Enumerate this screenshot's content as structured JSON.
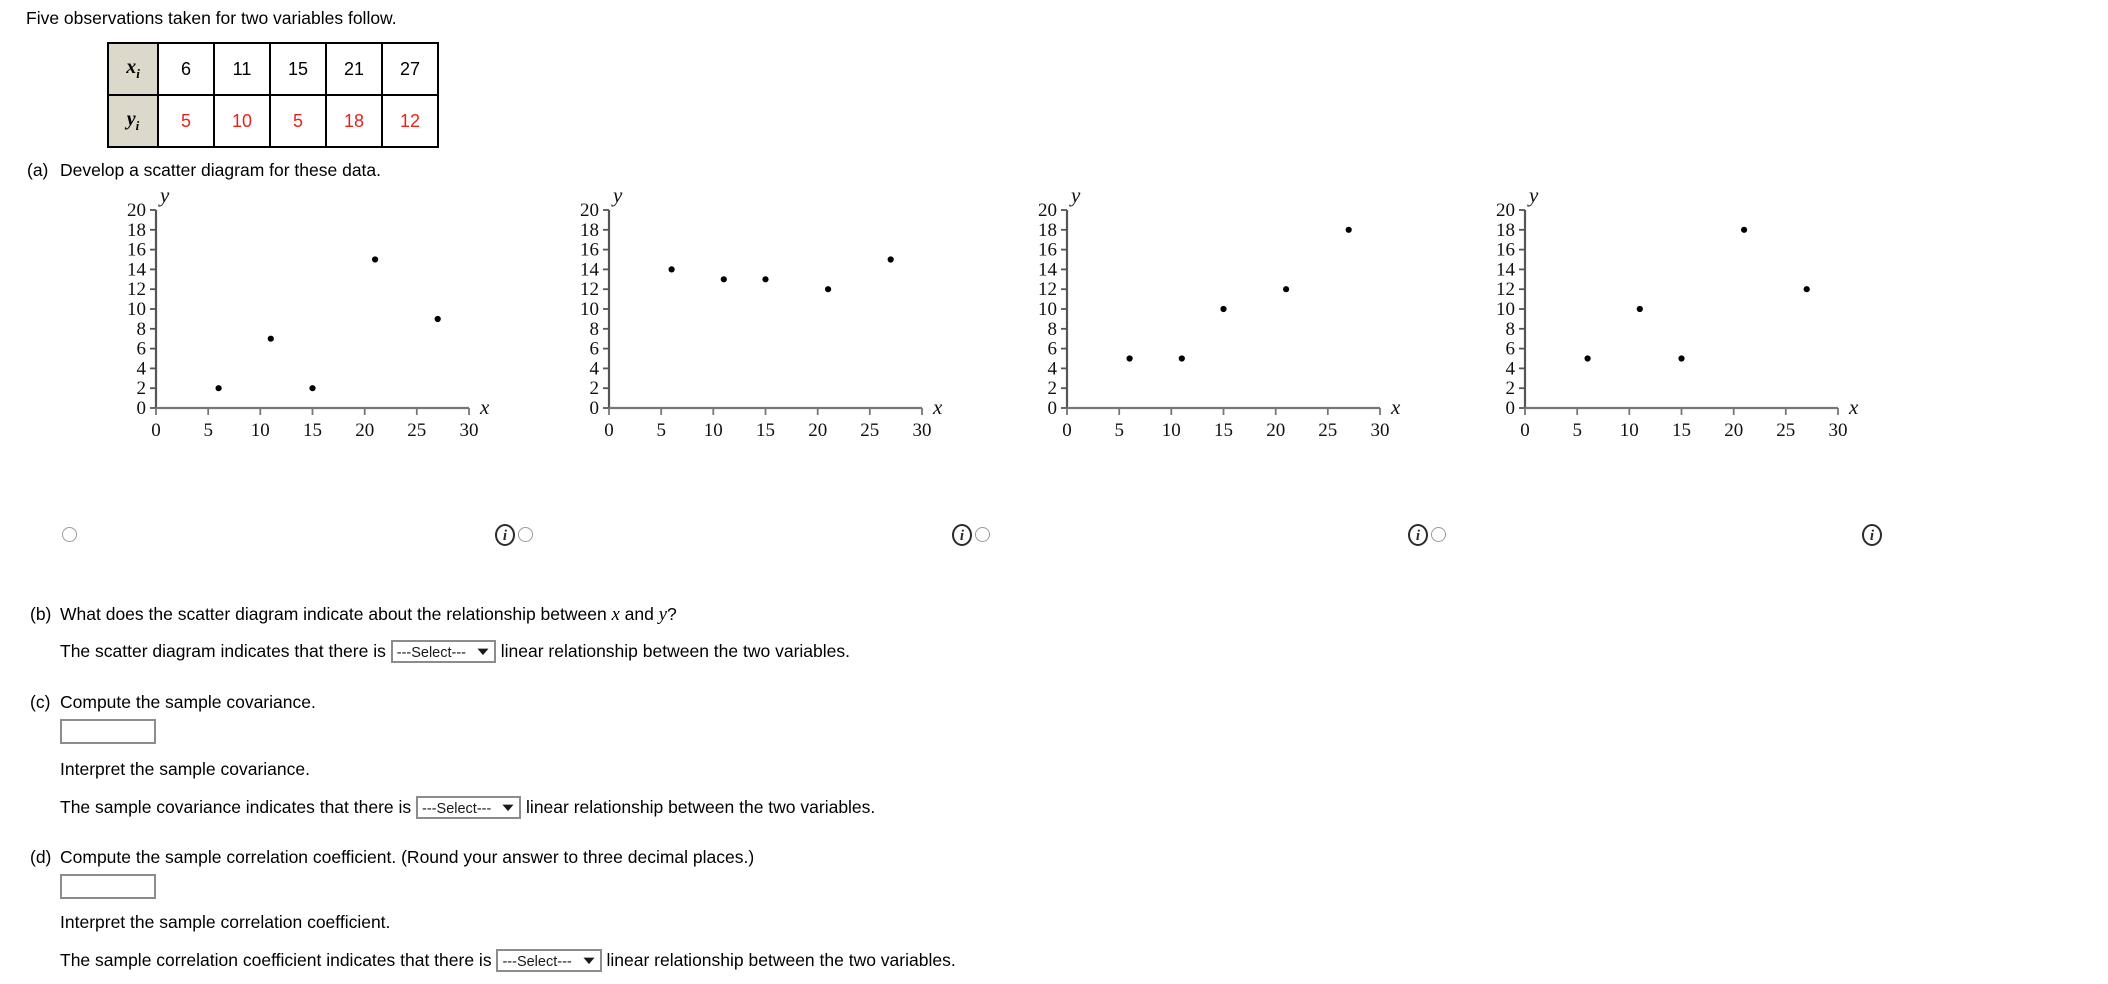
{
  "intro": "Five observations taken for two variables follow.",
  "data_table": {
    "row_x_label": "x",
    "row_x_sub": "i",
    "row_y_label": "y",
    "row_y_sub": "i",
    "x_values": [
      "6",
      "11",
      "15",
      "21",
      "27"
    ],
    "y_values": [
      "5",
      "10",
      "5",
      "18",
      "12"
    ],
    "y_color": "#e8231a",
    "header_bg": "#dcd9cb"
  },
  "parts": {
    "a": {
      "tag": "(a)",
      "text": "Develop a scatter diagram for these data."
    },
    "b": {
      "tag": "(b)",
      "question_pre": "What does the scatter diagram indicate about the relationship between ",
      "question_x": "x",
      "question_mid": " and ",
      "question_y": "y",
      "question_post": "?",
      "answer_pre": "The scatter diagram indicates that there is",
      "select_label": "---Select---",
      "answer_post": "linear relationship between the two variables."
    },
    "c": {
      "tag": "(c)",
      "prompt": "Compute the sample covariance.",
      "input_value": "",
      "interpret": "Interpret the sample covariance.",
      "answer_pre": "The sample covariance indicates that there is",
      "select_label": "---Select---",
      "answer_post": "linear relationship between the two variables."
    },
    "d": {
      "tag": "(d)",
      "prompt": "Compute the sample correlation coefficient. (Round your answer to three decimal places.)",
      "input_value": "",
      "interpret": "Interpret the sample correlation coefficient.",
      "answer_pre": "The sample correlation coefficient indicates that there is",
      "select_label": "---Select---",
      "answer_post": "linear relationship between the two variables."
    }
  },
  "chart_common": {
    "xlabel": "x",
    "ylabel": "y",
    "xticks": [
      "0",
      "5",
      "10",
      "15",
      "20",
      "25",
      "30"
    ],
    "yticks": [
      "0",
      "2",
      "4",
      "6",
      "8",
      "10",
      "12",
      "14",
      "16",
      "18",
      "20"
    ],
    "xlim": [
      0,
      30
    ],
    "ylim": [
      0,
      20
    ],
    "grid": false,
    "marker_color": "#000000"
  },
  "chart_data": [
    {
      "type": "scatter",
      "title": "",
      "xlabel": "x",
      "ylabel": "y",
      "xlim": [
        0,
        30
      ],
      "ylim": [
        0,
        20
      ],
      "xticks": [
        0,
        5,
        10,
        15,
        20,
        25,
        30
      ],
      "yticks": [
        0,
        2,
        4,
        6,
        8,
        10,
        12,
        14,
        16,
        18,
        20
      ],
      "grid": false,
      "x": [
        6,
        11,
        15,
        21,
        27
      ],
      "y": [
        2,
        7,
        2,
        15,
        9
      ],
      "option_label": "option-1"
    },
    {
      "type": "scatter",
      "title": "",
      "xlabel": "x",
      "ylabel": "y",
      "xlim": [
        0,
        30
      ],
      "ylim": [
        0,
        20
      ],
      "xticks": [
        0,
        5,
        10,
        15,
        20,
        25,
        30
      ],
      "yticks": [
        0,
        2,
        4,
        6,
        8,
        10,
        12,
        14,
        16,
        18,
        20
      ],
      "grid": false,
      "x": [
        6,
        11,
        15,
        21,
        27
      ],
      "y": [
        14,
        13,
        13,
        12,
        15
      ],
      "option_label": "option-2"
    },
    {
      "type": "scatter",
      "title": "",
      "xlabel": "x",
      "ylabel": "y",
      "xlim": [
        0,
        30
      ],
      "ylim": [
        0,
        20
      ],
      "xticks": [
        0,
        5,
        10,
        15,
        20,
        25,
        30
      ],
      "yticks": [
        0,
        2,
        4,
        6,
        8,
        10,
        12,
        14,
        16,
        18,
        20
      ],
      "grid": false,
      "x": [
        6,
        11,
        15,
        21,
        27
      ],
      "y": [
        5,
        5,
        10,
        12,
        18
      ],
      "option_label": "option-3"
    },
    {
      "type": "scatter",
      "title": "",
      "xlabel": "x",
      "ylabel": "y",
      "xlim": [
        0,
        30
      ],
      "ylim": [
        0,
        20
      ],
      "xticks": [
        0,
        5,
        10,
        15,
        20,
        25,
        30
      ],
      "yticks": [
        0,
        2,
        4,
        6,
        8,
        10,
        12,
        14,
        16,
        18,
        20
      ],
      "grid": false,
      "x": [
        6,
        11,
        15,
        21,
        27
      ],
      "y": [
        5,
        10,
        5,
        18,
        12
      ],
      "option_label": "option-4"
    }
  ],
  "icons": {
    "info": "i",
    "caret_down": "▼"
  }
}
